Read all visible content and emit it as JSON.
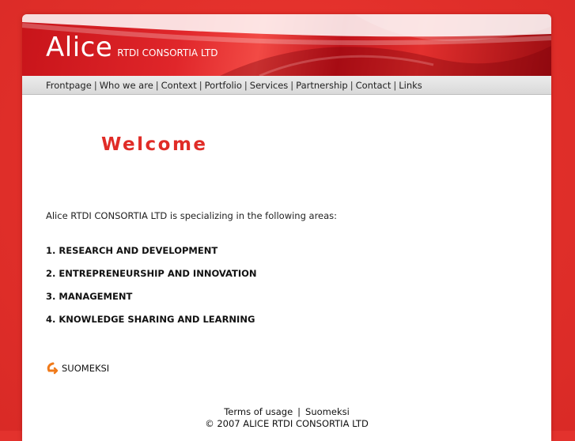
{
  "brand": {
    "name": "Alice",
    "subtitle": "RTDI CONSORTIA LTD"
  },
  "nav": {
    "items": [
      "Frontpage",
      "Who we are",
      "Context",
      "Portfolio",
      "Services",
      "Partnership",
      "Contact",
      "Links"
    ],
    "separator": "|"
  },
  "main": {
    "heading": "Welcome",
    "intro": "Alice RTDI CONSORTIA LTD is specializing in the following areas:",
    "areas": [
      "1. RESEARCH AND DEVELOPMENT",
      "2. ENTREPRENEURSHIP AND INNOVATION",
      "3. MANAGEMENT",
      "4. KNOWLEDGE SHARING AND LEARNING"
    ],
    "language_link": "SUOMEKSI"
  },
  "footer": {
    "terms": "Terms of usage",
    "separator": "|",
    "suomeksi": "Suomeksi",
    "copyright": "© 2007 ALICE RTDI CONSORTIA LTD"
  },
  "colors": {
    "background": "#e3322d",
    "accent": "#e02c27",
    "arrow": "#f07a1a"
  },
  "icons": {
    "language_arrow": "curved-arrow-icon"
  }
}
